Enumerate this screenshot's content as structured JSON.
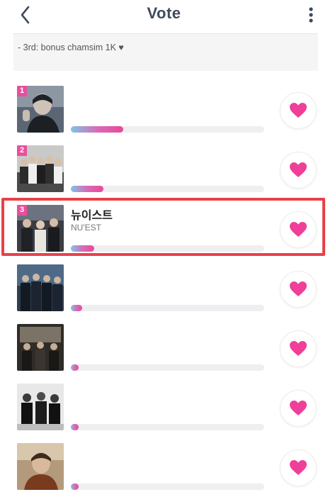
{
  "header": {
    "title": "Vote",
    "back_icon": "chevron-left-icon",
    "menu_icon": "more-vertical-icon"
  },
  "notice": {
    "text": "- 3rd: bonus chamsim 1K ♥"
  },
  "accent_color": "#e94e9c",
  "highlight_color": "#e8414a",
  "candidates": [
    {
      "rank": "1",
      "name": "",
      "sub": "",
      "progress": 0.27
    },
    {
      "rank": "2",
      "name": "",
      "sub": "",
      "progress": 0.17
    },
    {
      "rank": "3",
      "name": "뉴이스트",
      "sub": "NU'EST",
      "progress": 0.12
    },
    {
      "rank": "",
      "name": "",
      "sub": "",
      "progress": 0.06
    },
    {
      "rank": "",
      "name": "",
      "sub": "",
      "progress": 0.04
    },
    {
      "rank": "",
      "name": "",
      "sub": "",
      "progress": 0.04
    },
    {
      "rank": "",
      "name": "",
      "sub": "",
      "progress": 0.04
    }
  ]
}
